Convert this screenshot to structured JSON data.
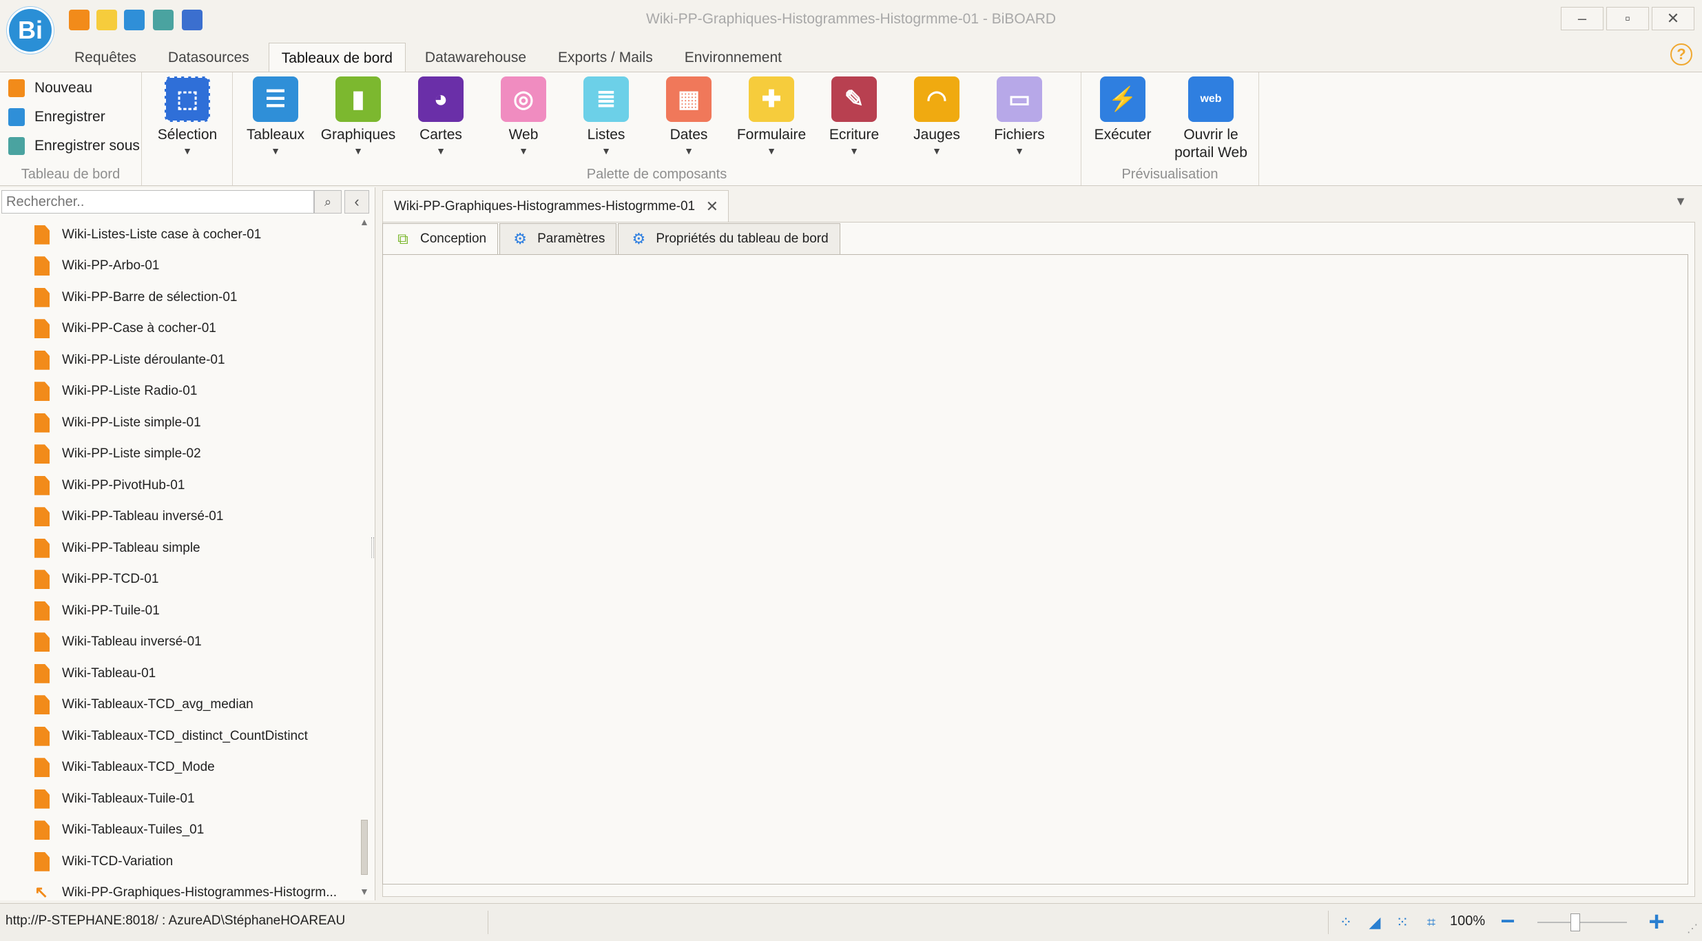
{
  "window": {
    "title": "Wiki-PP-Graphiques-Histogrammes-Histogrmme-01 - BiBOARD",
    "logo_text": "Bi",
    "minimize": "–",
    "maximize": "▫",
    "close": "✕"
  },
  "ribbon_tabs": [
    "Requêtes",
    "Datasources",
    "Tableaux de bord",
    "Datawarehouse",
    "Exports / Mails",
    "Environnement"
  ],
  "ribbon": {
    "file_group": {
      "new_label": "Nouveau",
      "save_label": "Enregistrer",
      "save_as_label": "Enregistrer sous",
      "group_label": "Tableau de bord"
    },
    "selection_label": "Sélection",
    "palette_group_label": "Palette de composants",
    "components": [
      {
        "label": "Tableaux",
        "icon": "table-icon",
        "color": "#2f8fd8"
      },
      {
        "label": "Graphiques",
        "icon": "bar-chart-icon",
        "color": "#7cb82f"
      },
      {
        "label": "Cartes",
        "icon": "globe-icon",
        "color": "#6a2fa8"
      },
      {
        "label": "Web",
        "icon": "web-icon",
        "color": "#f08cc0"
      },
      {
        "label": "Listes",
        "icon": "list-icon",
        "color": "#6cd0e8"
      },
      {
        "label": "Dates",
        "icon": "calendar-icon",
        "color": "#f0785a"
      },
      {
        "label": "Formulaire",
        "icon": "plus-circle-icon",
        "color": "#f6cc3c"
      },
      {
        "label": "Ecriture",
        "icon": "pen-icon",
        "color": "#b84050"
      },
      {
        "label": "Jauges",
        "icon": "gauge-icon",
        "color": "#f0aa10"
      },
      {
        "label": "Fichiers",
        "icon": "folder-icon",
        "color": "#b7a8e8"
      }
    ],
    "preview_group": {
      "execute_label": "Exécuter",
      "open_portal_line1": "Ouvrir le",
      "open_portal_line2": "portail Web",
      "web_badge": "web",
      "group_label": "Prévisualisation"
    }
  },
  "left_panel": {
    "search_placeholder": "Rechercher..",
    "items": [
      "Wiki-Listes-Liste case à cocher-01",
      "Wiki-PP-Arbo-01",
      "Wiki-PP-Barre de sélection-01",
      "Wiki-PP-Case à cocher-01",
      "Wiki-PP-Liste déroulante-01",
      "Wiki-PP-Liste Radio-01",
      "Wiki-PP-Liste simple-01",
      "Wiki-PP-Liste simple-02",
      "Wiki-PP-PivotHub-01",
      "Wiki-PP-Tableau inversé-01",
      "Wiki-PP-Tableau simple",
      "Wiki-PP-TCD-01",
      "Wiki-PP-Tuile-01",
      "Wiki-Tableau inversé-01",
      "Wiki-Tableau-01",
      "Wiki-Tableaux-TCD_avg_median",
      "Wiki-Tableaux-TCD_distinct_CountDistinct",
      "Wiki-Tableaux-TCD_Mode",
      "Wiki-Tableaux-Tuile-01",
      "Wiki-Tableaux-Tuiles_01",
      "Wiki-TCD-Variation",
      "Wiki-PP-Graphiques-Histogrammes-Histogrm..."
    ]
  },
  "document": {
    "tab_label": "Wiki-PP-Graphiques-Histogrammes-Histogrmme-01",
    "sub_tabs": [
      "Conception",
      "Paramètres",
      "Propriétés du tableau de bord"
    ]
  },
  "status": {
    "connection": "http://P-STEPHANE:8018/ : AzureAD\\StéphaneHOAREAU",
    "zoom": "100%",
    "zoom_fraction": 0.42
  }
}
